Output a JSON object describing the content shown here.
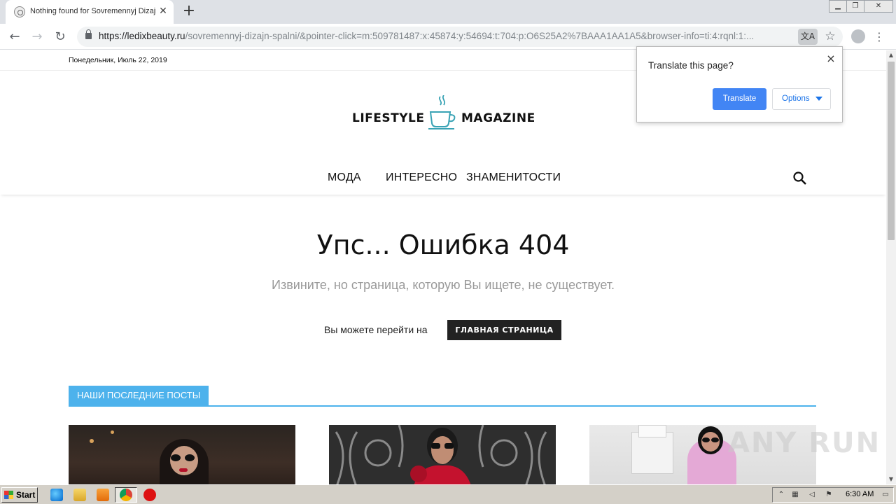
{
  "browser": {
    "tab_title": "Nothing found for Sovremennyj Dizajn Spalni",
    "tab_close": "✕",
    "new_tab": "+",
    "url_host": "https://ledixbeauty.ru",
    "url_rest": "/sovremennyj-dizajn-spalni/&pointer-click=m:509781487:x:45874:y:54694:t:704:p:O6S25A2%7BAAA1AA1A5&browser-info=ti:4:rqnl:1:...",
    "window_controls": [
      "▁",
      "❐",
      "✕"
    ]
  },
  "translate_bubble": {
    "question": "Translate this page?",
    "translate_label": "Translate",
    "options_label": "Options",
    "close": "×"
  },
  "site": {
    "date": "Понедельник, Июль 22, 2019",
    "logo_left": "LIFESTYLE",
    "logo_right": "MAGAZINE",
    "nav": [
      "МОДА",
      "ИНТЕРЕСНО",
      "ЗНАМЕНИТОСТИ"
    ],
    "accent_color": "#4db2ec"
  },
  "error": {
    "title": "Упс... Ошибка 404",
    "subtitle": "Извините, но страница, которую Вы ищете, не существует.",
    "go_text": "Вы можете перейти на",
    "home_button": "ГЛАВНАЯ СТРАНИЦА"
  },
  "latest": {
    "block_title": "НАШИ ПОСЛЕДНИЕ ПОСТЫ"
  },
  "watermark": "ANY RUN",
  "taskbar": {
    "start_label": "Start",
    "clock": "6:30 AM"
  }
}
